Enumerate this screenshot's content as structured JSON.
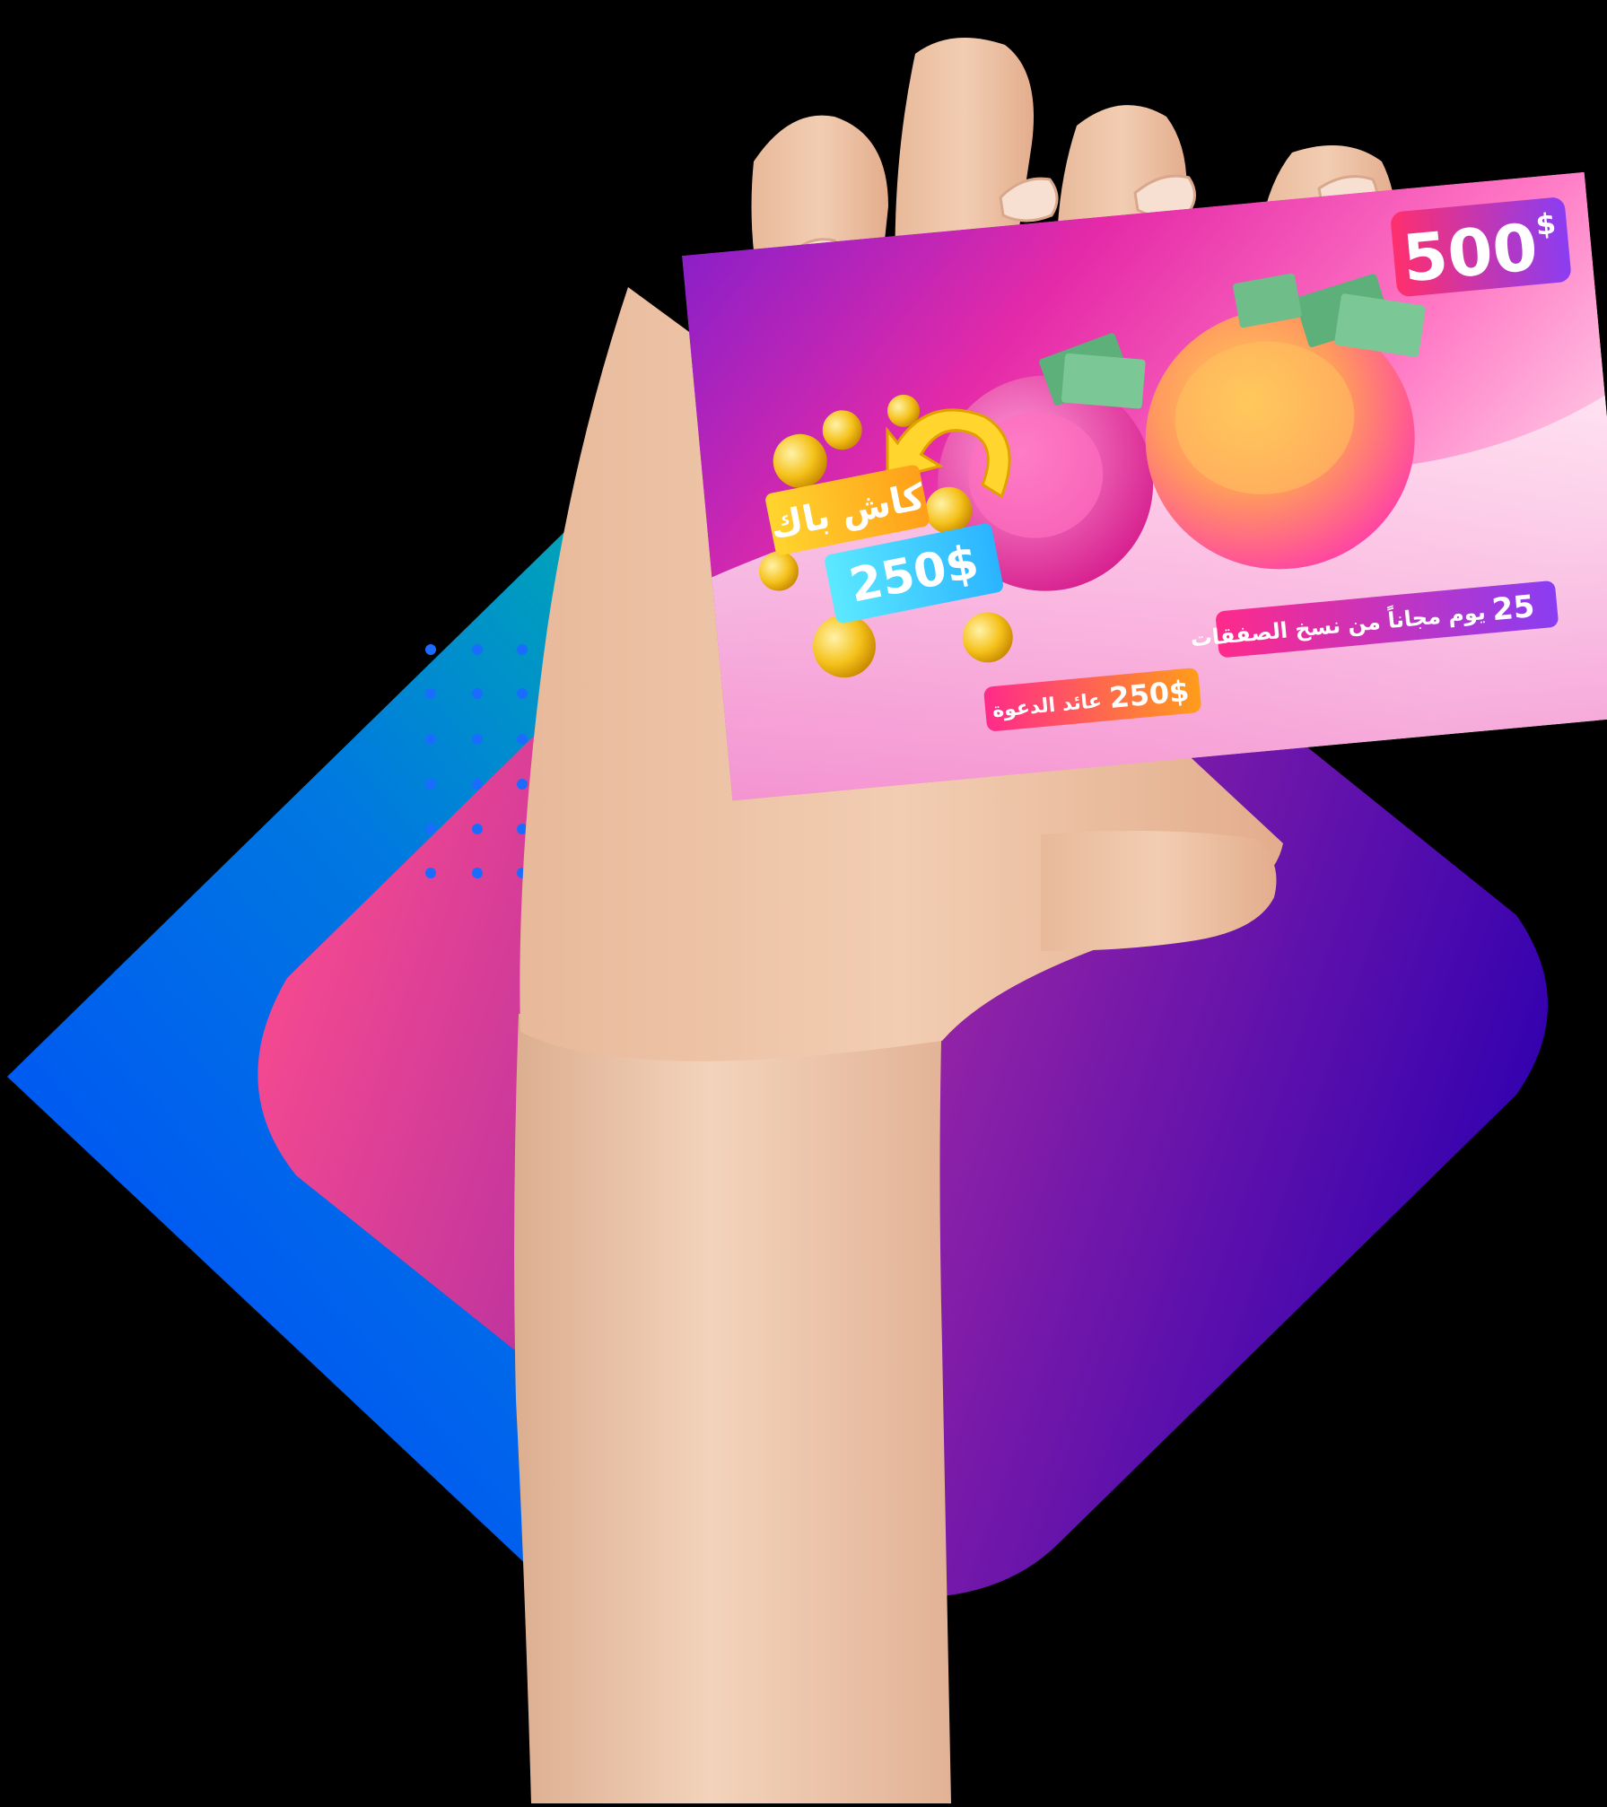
{
  "card": {
    "amount": "500",
    "amount_currency": "$",
    "cashback_label": "كاش باك",
    "cashback_amount": "250$",
    "copy_trading_days": "25",
    "copy_trading_text": "يوم مجاناً من نسخ الصفقات",
    "referral_amount": "250$",
    "referral_text": "عائد الدعوة"
  },
  "colors": {
    "diamond_blue": "#0055ff",
    "diamond_teal": "#00c49a",
    "diamond_pink": "#ff4d8d",
    "diamond_purple": "#2f00b0",
    "dots_blue": "#1a6cff",
    "card_magenta": "#e52aa8",
    "card_pink": "#ff77c4"
  }
}
